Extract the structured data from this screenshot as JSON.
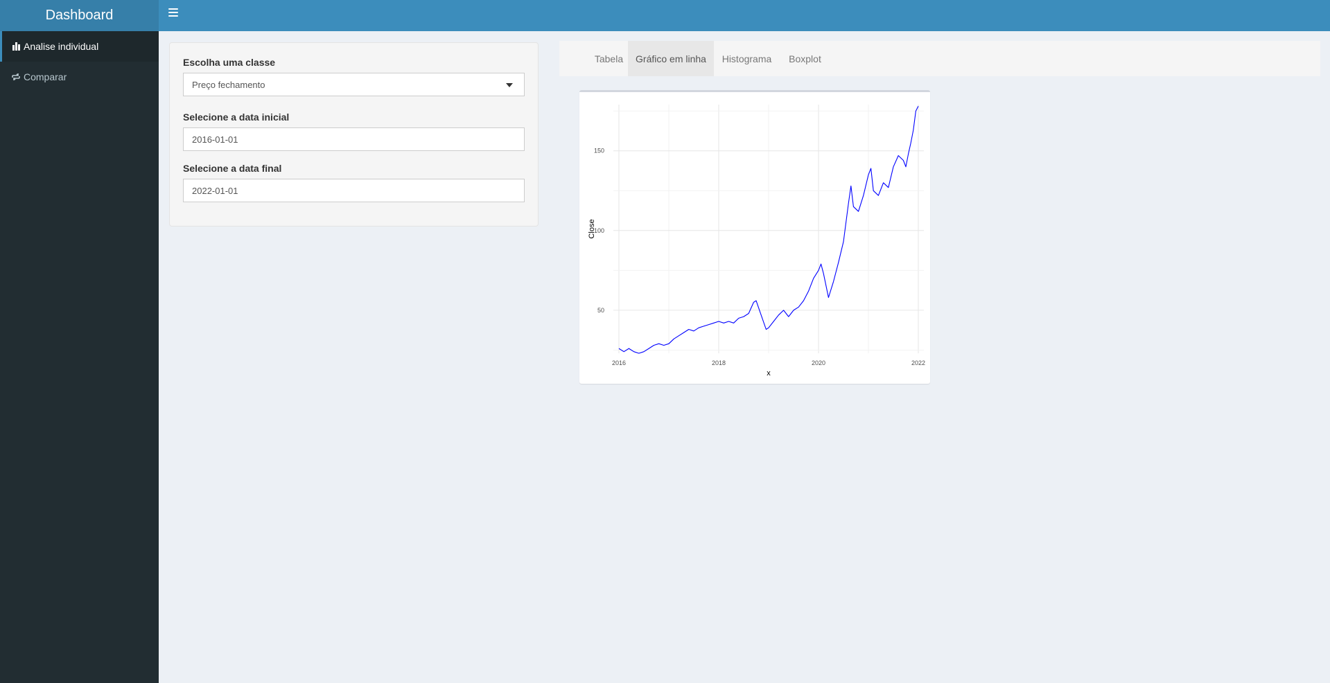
{
  "app": {
    "title": "Dashboard"
  },
  "sidebar": {
    "items": [
      {
        "label": "Analise individual",
        "icon": "bar-chart-icon",
        "active": true
      },
      {
        "label": "Comparar",
        "icon": "exchange-icon",
        "active": false
      }
    ]
  },
  "form": {
    "class_label": "Escolha uma classe",
    "class_value": "Preço fechamento",
    "start_label": "Selecione a data inicial",
    "start_value": "2016-01-01",
    "end_label": "Selecione a data final",
    "end_value": "2022-01-01"
  },
  "tabs": [
    {
      "label": "Tabela",
      "active": false
    },
    {
      "label": "Gráfico em linha",
      "active": true
    },
    {
      "label": "Histograma",
      "active": false
    },
    {
      "label": "Boxplot",
      "active": false
    }
  ],
  "colors": {
    "header": "#3c8dbc",
    "logo": "#367fa9",
    "sidebar": "#222d32",
    "line": "#0000ff"
  },
  "chart_data": {
    "type": "line",
    "title": "",
    "xlabel": "x",
    "ylabel": "Close",
    "xlim": [
      2016.0,
      2022.0
    ],
    "ylim": [
      23,
      179
    ],
    "x_ticks": [
      "2016",
      "2018",
      "2020",
      "2022"
    ],
    "y_ticks": [
      "50",
      "100",
      "150"
    ],
    "grid": true,
    "series": [
      {
        "color": "#0000ff",
        "points": [
          [
            2016.0,
            26
          ],
          [
            2016.1,
            24
          ],
          [
            2016.2,
            26
          ],
          [
            2016.3,
            24
          ],
          [
            2016.4,
            23
          ],
          [
            2016.5,
            24
          ],
          [
            2016.6,
            26
          ],
          [
            2016.7,
            28
          ],
          [
            2016.8,
            29
          ],
          [
            2016.9,
            28
          ],
          [
            2017.0,
            29
          ],
          [
            2017.1,
            32
          ],
          [
            2017.2,
            34
          ],
          [
            2017.3,
            36
          ],
          [
            2017.4,
            38
          ],
          [
            2017.5,
            37
          ],
          [
            2017.6,
            39
          ],
          [
            2017.7,
            40
          ],
          [
            2017.8,
            41
          ],
          [
            2017.9,
            42
          ],
          [
            2018.0,
            43
          ],
          [
            2018.1,
            42
          ],
          [
            2018.2,
            43
          ],
          [
            2018.3,
            42
          ],
          [
            2018.4,
            45
          ],
          [
            2018.5,
            46
          ],
          [
            2018.6,
            48
          ],
          [
            2018.7,
            55
          ],
          [
            2018.75,
            56
          ],
          [
            2018.85,
            47
          ],
          [
            2018.95,
            38
          ],
          [
            2019.0,
            39
          ],
          [
            2019.1,
            43
          ],
          [
            2019.2,
            47
          ],
          [
            2019.3,
            50
          ],
          [
            2019.4,
            46
          ],
          [
            2019.5,
            50
          ],
          [
            2019.6,
            52
          ],
          [
            2019.7,
            56
          ],
          [
            2019.8,
            62
          ],
          [
            2019.9,
            70
          ],
          [
            2020.0,
            75
          ],
          [
            2020.05,
            79
          ],
          [
            2020.1,
            73
          ],
          [
            2020.2,
            58
          ],
          [
            2020.3,
            68
          ],
          [
            2020.4,
            80
          ],
          [
            2020.5,
            93
          ],
          [
            2020.6,
            117
          ],
          [
            2020.65,
            128
          ],
          [
            2020.7,
            115
          ],
          [
            2020.8,
            112
          ],
          [
            2020.9,
            122
          ],
          [
            2021.0,
            135
          ],
          [
            2021.05,
            139
          ],
          [
            2021.1,
            125
          ],
          [
            2021.2,
            122
          ],
          [
            2021.3,
            130
          ],
          [
            2021.4,
            127
          ],
          [
            2021.5,
            140
          ],
          [
            2021.6,
            147
          ],
          [
            2021.7,
            144
          ],
          [
            2021.75,
            140
          ],
          [
            2021.8,
            148
          ],
          [
            2021.85,
            155
          ],
          [
            2021.9,
            163
          ],
          [
            2021.95,
            175
          ],
          [
            2022.0,
            178
          ]
        ]
      }
    ]
  }
}
